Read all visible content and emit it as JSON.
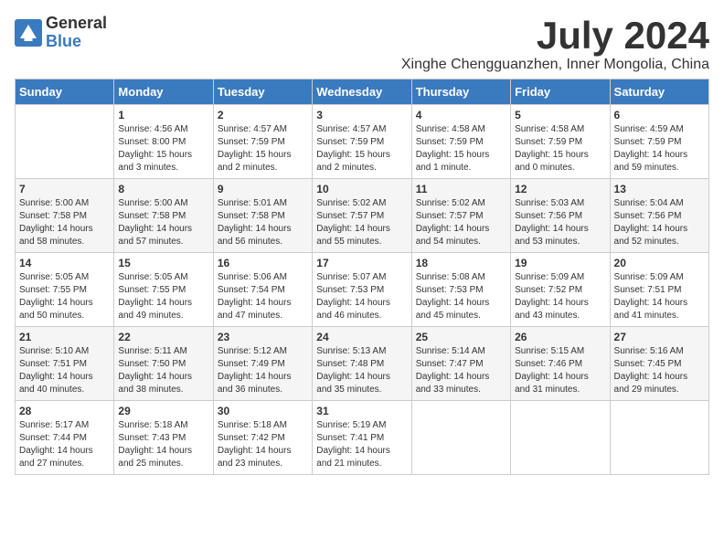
{
  "logo": {
    "general": "General",
    "blue": "Blue"
  },
  "header": {
    "month": "July 2024",
    "location": "Xinghe Chengguanzhen, Inner Mongolia, China"
  },
  "weekdays": [
    "Sunday",
    "Monday",
    "Tuesday",
    "Wednesday",
    "Thursday",
    "Friday",
    "Saturday"
  ],
  "weeks": [
    [
      {
        "day": "",
        "info": ""
      },
      {
        "day": "1",
        "info": "Sunrise: 4:56 AM\nSunset: 8:00 PM\nDaylight: 15 hours\nand 3 minutes."
      },
      {
        "day": "2",
        "info": "Sunrise: 4:57 AM\nSunset: 7:59 PM\nDaylight: 15 hours\nand 2 minutes."
      },
      {
        "day": "3",
        "info": "Sunrise: 4:57 AM\nSunset: 7:59 PM\nDaylight: 15 hours\nand 2 minutes."
      },
      {
        "day": "4",
        "info": "Sunrise: 4:58 AM\nSunset: 7:59 PM\nDaylight: 15 hours\nand 1 minute."
      },
      {
        "day": "5",
        "info": "Sunrise: 4:58 AM\nSunset: 7:59 PM\nDaylight: 15 hours\nand 0 minutes."
      },
      {
        "day": "6",
        "info": "Sunrise: 4:59 AM\nSunset: 7:59 PM\nDaylight: 14 hours\nand 59 minutes."
      }
    ],
    [
      {
        "day": "7",
        "info": "Sunrise: 5:00 AM\nSunset: 7:58 PM\nDaylight: 14 hours\nand 58 minutes."
      },
      {
        "day": "8",
        "info": "Sunrise: 5:00 AM\nSunset: 7:58 PM\nDaylight: 14 hours\nand 57 minutes."
      },
      {
        "day": "9",
        "info": "Sunrise: 5:01 AM\nSunset: 7:58 PM\nDaylight: 14 hours\nand 56 minutes."
      },
      {
        "day": "10",
        "info": "Sunrise: 5:02 AM\nSunset: 7:57 PM\nDaylight: 14 hours\nand 55 minutes."
      },
      {
        "day": "11",
        "info": "Sunrise: 5:02 AM\nSunset: 7:57 PM\nDaylight: 14 hours\nand 54 minutes."
      },
      {
        "day": "12",
        "info": "Sunrise: 5:03 AM\nSunset: 7:56 PM\nDaylight: 14 hours\nand 53 minutes."
      },
      {
        "day": "13",
        "info": "Sunrise: 5:04 AM\nSunset: 7:56 PM\nDaylight: 14 hours\nand 52 minutes."
      }
    ],
    [
      {
        "day": "14",
        "info": "Sunrise: 5:05 AM\nSunset: 7:55 PM\nDaylight: 14 hours\nand 50 minutes."
      },
      {
        "day": "15",
        "info": "Sunrise: 5:05 AM\nSunset: 7:55 PM\nDaylight: 14 hours\nand 49 minutes."
      },
      {
        "day": "16",
        "info": "Sunrise: 5:06 AM\nSunset: 7:54 PM\nDaylight: 14 hours\nand 47 minutes."
      },
      {
        "day": "17",
        "info": "Sunrise: 5:07 AM\nSunset: 7:53 PM\nDaylight: 14 hours\nand 46 minutes."
      },
      {
        "day": "18",
        "info": "Sunrise: 5:08 AM\nSunset: 7:53 PM\nDaylight: 14 hours\nand 45 minutes."
      },
      {
        "day": "19",
        "info": "Sunrise: 5:09 AM\nSunset: 7:52 PM\nDaylight: 14 hours\nand 43 minutes."
      },
      {
        "day": "20",
        "info": "Sunrise: 5:09 AM\nSunset: 7:51 PM\nDaylight: 14 hours\nand 41 minutes."
      }
    ],
    [
      {
        "day": "21",
        "info": "Sunrise: 5:10 AM\nSunset: 7:51 PM\nDaylight: 14 hours\nand 40 minutes."
      },
      {
        "day": "22",
        "info": "Sunrise: 5:11 AM\nSunset: 7:50 PM\nDaylight: 14 hours\nand 38 minutes."
      },
      {
        "day": "23",
        "info": "Sunrise: 5:12 AM\nSunset: 7:49 PM\nDaylight: 14 hours\nand 36 minutes."
      },
      {
        "day": "24",
        "info": "Sunrise: 5:13 AM\nSunset: 7:48 PM\nDaylight: 14 hours\nand 35 minutes."
      },
      {
        "day": "25",
        "info": "Sunrise: 5:14 AM\nSunset: 7:47 PM\nDaylight: 14 hours\nand 33 minutes."
      },
      {
        "day": "26",
        "info": "Sunrise: 5:15 AM\nSunset: 7:46 PM\nDaylight: 14 hours\nand 31 minutes."
      },
      {
        "day": "27",
        "info": "Sunrise: 5:16 AM\nSunset: 7:45 PM\nDaylight: 14 hours\nand 29 minutes."
      }
    ],
    [
      {
        "day": "28",
        "info": "Sunrise: 5:17 AM\nSunset: 7:44 PM\nDaylight: 14 hours\nand 27 minutes."
      },
      {
        "day": "29",
        "info": "Sunrise: 5:18 AM\nSunset: 7:43 PM\nDaylight: 14 hours\nand 25 minutes."
      },
      {
        "day": "30",
        "info": "Sunrise: 5:18 AM\nSunset: 7:42 PM\nDaylight: 14 hours\nand 23 minutes."
      },
      {
        "day": "31",
        "info": "Sunrise: 5:19 AM\nSunset: 7:41 PM\nDaylight: 14 hours\nand 21 minutes."
      },
      {
        "day": "",
        "info": ""
      },
      {
        "day": "",
        "info": ""
      },
      {
        "day": "",
        "info": ""
      }
    ]
  ]
}
